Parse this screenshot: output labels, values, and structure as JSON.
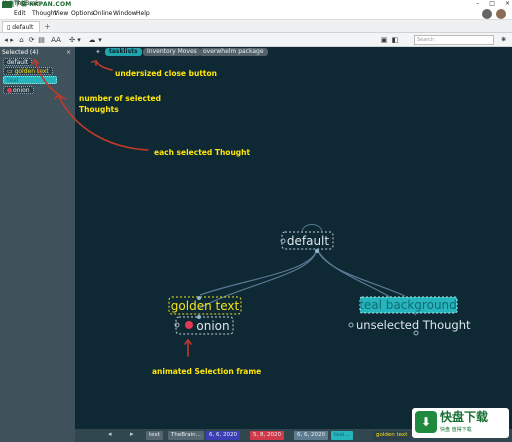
{
  "window": {
    "title": "TheBrain",
    "minimize": "–",
    "maximize": "□",
    "close": "×"
  },
  "watermark": {
    "site": "快盘下载 KKPAN.COM",
    "brand_cn": "快盘下载",
    "brand_sub": "快盘 值得下载"
  },
  "menu": {
    "items": [
      "Edit",
      "Thought",
      "View",
      "Options",
      "Online",
      "Window",
      "Help"
    ]
  },
  "tabs": [
    {
      "label": "default"
    }
  ],
  "toolbar": {
    "search_placeholder": "Search",
    "buttons": [
      "◂",
      "▸",
      "⌂",
      "⟳",
      "▤",
      "AA",
      "✣",
      "▾",
      "☁",
      "▾"
    ]
  },
  "selection_panel": {
    "header": "Selected (4)",
    "close_label": "×",
    "items": [
      {
        "label": "default",
        "style": "plain"
      },
      {
        "label": "golden text",
        "style": "golden"
      },
      {
        "label": "teal background",
        "style": "teal"
      },
      {
        "label": "onion",
        "style": "onion"
      }
    ]
  },
  "map_tabs": [
    {
      "label": "tasklists",
      "active": true
    },
    {
      "label": "Inventory Moves",
      "active": false
    },
    {
      "label": "overwhelm package",
      "active": false
    }
  ],
  "thoughts": {
    "default": "default",
    "golden": "golden text",
    "onion": "onion",
    "teal": "teal background",
    "unselected": "unselected Thought"
  },
  "annotations": {
    "close_button": "undersized close button",
    "count_line1": "number of selected",
    "count_line2": "Thoughts",
    "each_selected": "each selected Thought",
    "animated": "animated Selection frame"
  },
  "statusbar": {
    "items": [
      "text",
      "TheBrain...",
      "6, 6, 2020",
      "5, 8, 2020",
      "6, 6, 2020",
      "teal...",
      "golden text",
      "onion",
      "unselected..."
    ]
  },
  "colors": {
    "map_bg": "#0e2834",
    "left_pane": "#3f515a",
    "golden": "#f2e31c",
    "teal": "#27b5bd",
    "onion": "#e23a52",
    "annotation": "#ffe60a",
    "arrow": "#c0392b"
  }
}
